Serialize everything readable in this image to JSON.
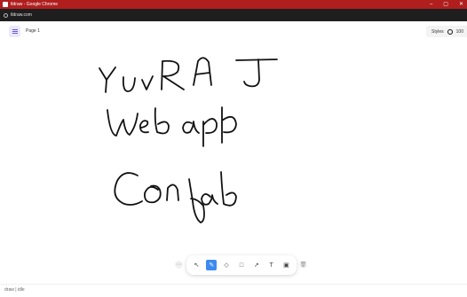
{
  "window": {
    "title": "tldraw - Google Chrome",
    "controls": [
      "–",
      "▢",
      "✕"
    ]
  },
  "address": {
    "url": "tldraw.com"
  },
  "page": {
    "label": "Page 1"
  },
  "styles": {
    "label": "Styles",
    "zoom": "100"
  },
  "toolbar": {
    "tools": [
      {
        "name": "select-tool",
        "glyph": "↖"
      },
      {
        "name": "draw-tool",
        "glyph": "✎",
        "active": true
      },
      {
        "name": "eraser-tool",
        "glyph": "◇"
      },
      {
        "name": "rectangle-tool",
        "glyph": "□"
      },
      {
        "name": "arrow-tool",
        "glyph": "↗"
      },
      {
        "name": "text-tool",
        "glyph": "T"
      },
      {
        "name": "sticky-note-tool",
        "glyph": "▣"
      }
    ],
    "left_btn": "⋯",
    "right_btn": "🗑"
  },
  "status": {
    "text": "draw | idle"
  },
  "colors": {
    "titlebar": "#b01e1e",
    "accent": "#3d8bf0"
  }
}
